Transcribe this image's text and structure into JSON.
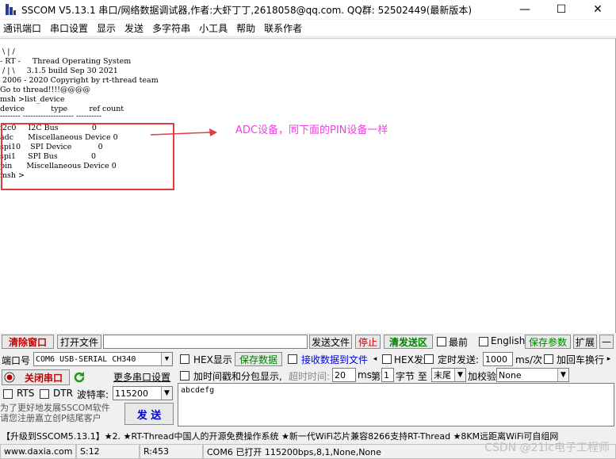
{
  "title_bar": {
    "title": "SSCOM V5.13.1 串口/网络数据调试器,作者:大虾丁丁,2618058@qq.com. QQ群: 52502449(最新版本)",
    "minimize": "—",
    "maximize": "☐",
    "close": "✕"
  },
  "menu": [
    "通讯端口",
    "串口设置",
    "显示",
    "发送",
    "多字符串",
    "小工具",
    "帮助",
    "联系作者"
  ],
  "terminal": {
    "lines": [
      " \\ | /",
      "- RT -     Thread Operating System",
      " / | \\     3.1.5 build Sep 30 2021",
      " 2006 - 2020 Copyright by rt-thread team",
      "Go to thread!!!!@@@@",
      "msh >list_device",
      "device           type         ref count",
      "-------- -------------------- ----------",
      "i2c0     I2C Bus              0",
      "adc      Miscellaneous Device 0",
      "spi10    SPI Device           0",
      "spi1     SPI Bus              0",
      "pin      Miscellaneous Device 0",
      "msh >"
    ]
  },
  "annotation": {
    "text": "ADC设备，同下面的PIN设备一样",
    "color": "#f43ee6",
    "box_color": "#e43b3b"
  },
  "toolbar1": {
    "clear_window": "清除窗口",
    "open_file": "打开文件",
    "file_path": "",
    "send_file": "发送文件",
    "stop": "停止",
    "clear_send": "清发送区",
    "topmost": "最前",
    "english": "English",
    "save_params": "保存参数",
    "expand": "扩展",
    "collapse": "—"
  },
  "port_panel": {
    "port_label": "端口号",
    "port_value": "COM6 USB-SERIAL CH340",
    "close_port": "关闭串口",
    "more_settings": "更多串口设置",
    "rts": "RTS",
    "dtr": "DTR",
    "baud_label": "波特率:",
    "baud_value": "115200",
    "promo1": "为了更好地发展SSCOM软件",
    "promo2": "请您注册嘉立创P结尾客户",
    "send": "发 送"
  },
  "options_row2": {
    "hex_display": "HEX显示",
    "save_data": "保存数据",
    "recv_to_file": "接收数据到文件",
    "hex_send": "HEX发送",
    "timed_send": "定时发送:",
    "interval": "1000",
    "interval_unit": "ms/次",
    "append_crlf": "加回车换行"
  },
  "options_row3": {
    "timestamp": "加时间戳和分包显示,",
    "timeout_label": "超时时间:",
    "timeout_value": "20",
    "ms": "ms",
    "nth": "第",
    "byte_index": "1",
    "byte_to": "字节 至",
    "byte_end": "末尾",
    "checksum_label": "加校验",
    "checksum_value": "None"
  },
  "send_text": "abcdefg",
  "ticker": "【升级到SSCOM5.13.1】★2. ★RT-Thread中国人的开源免费操作系统 ★新一代WiFi芯片兼容8266支持RT-Thread ★8KM远距离WiFi可自组网",
  "status_bar": {
    "website": "www.daxia.com",
    "sent": "S:12",
    "received": "R:453",
    "port_status": "COM6 已打开  115200bps,8,1,None,None"
  },
  "watermark": "CSDN @21ic电子工程师",
  "colors": {
    "red_text": "#c00000",
    "green_text": "#008000",
    "blue_text": "#0000cc"
  }
}
